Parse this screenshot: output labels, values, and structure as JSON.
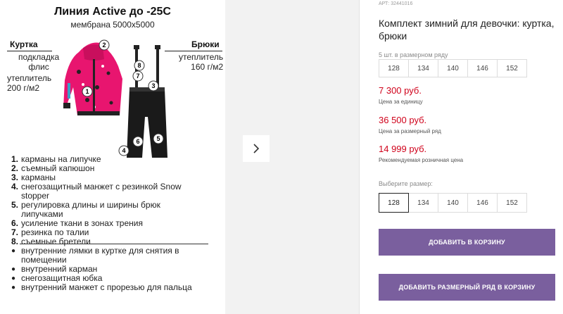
{
  "image": {
    "title": "Линия Active до -25С",
    "subtitle": "мембрана 5000x5000",
    "jacket": {
      "heading": "Куртка",
      "lining": [
        "подкладка",
        "флис"
      ],
      "insulation": [
        "утеплитель",
        "200 г/м2"
      ]
    },
    "pants": {
      "heading": "Брюки",
      "insulation": [
        "утеплитель",
        "160 г/м2"
      ]
    },
    "callouts": [
      "1",
      "2",
      "3",
      "4",
      "5",
      "6",
      "7",
      "8"
    ],
    "features": [
      {
        "n": "1.",
        "text": "карманы на липучке"
      },
      {
        "n": "2.",
        "text": "съемный капюшон"
      },
      {
        "n": "3.",
        "text": "карманы"
      },
      {
        "n": "4.",
        "text": "снегозащитный манжет с резинкой Snow stopper"
      },
      {
        "n": "5.",
        "text": "регулировка длины и ширины брюк липучками"
      },
      {
        "n": "6.",
        "text": "усиление ткани в зонах трения"
      },
      {
        "n": "7.",
        "text": "резинка по талии"
      },
      {
        "n": "8.",
        "text": "съемные бретели"
      }
    ],
    "extras": [
      "внутренние лямки в куртке для снятия в помещении",
      "внутренний карман",
      "снегозащитная юбка",
      "внутренний манжет с прорезью для пальца"
    ]
  },
  "gallery": {
    "next_icon": "chevron-right-icon"
  },
  "product": {
    "article": "АРТ: 32441016",
    "title": "Комплект зимний для девочки: куртка, брюки",
    "pack_label": "5 шт. в размерном ряду",
    "pack_sizes": [
      "128",
      "134",
      "140",
      "146",
      "152"
    ],
    "price_unit": "7 300 руб.",
    "price_unit_note": "Цена за единицу",
    "price_pack": "36 500 руб.",
    "price_pack_note": "Цена за размерный ряд",
    "price_retail": "14 999 руб.",
    "price_retail_note": "Рекомендуемая розничная цена",
    "choose_size_label": "Выберите размер:",
    "sizes": [
      "128",
      "134",
      "140",
      "146",
      "152"
    ],
    "selected_size": "128",
    "add_to_cart": "ДОБАВИТЬ В КОРЗИНУ",
    "add_pack_to_cart": "ДОБАВИТЬ РАЗМЕРНЫЙ РЯД В КОРЗИНУ"
  },
  "colors": {
    "accent_button": "#7a5f9e",
    "price": "#d0021b",
    "jacket_pink": "#e8156f"
  }
}
